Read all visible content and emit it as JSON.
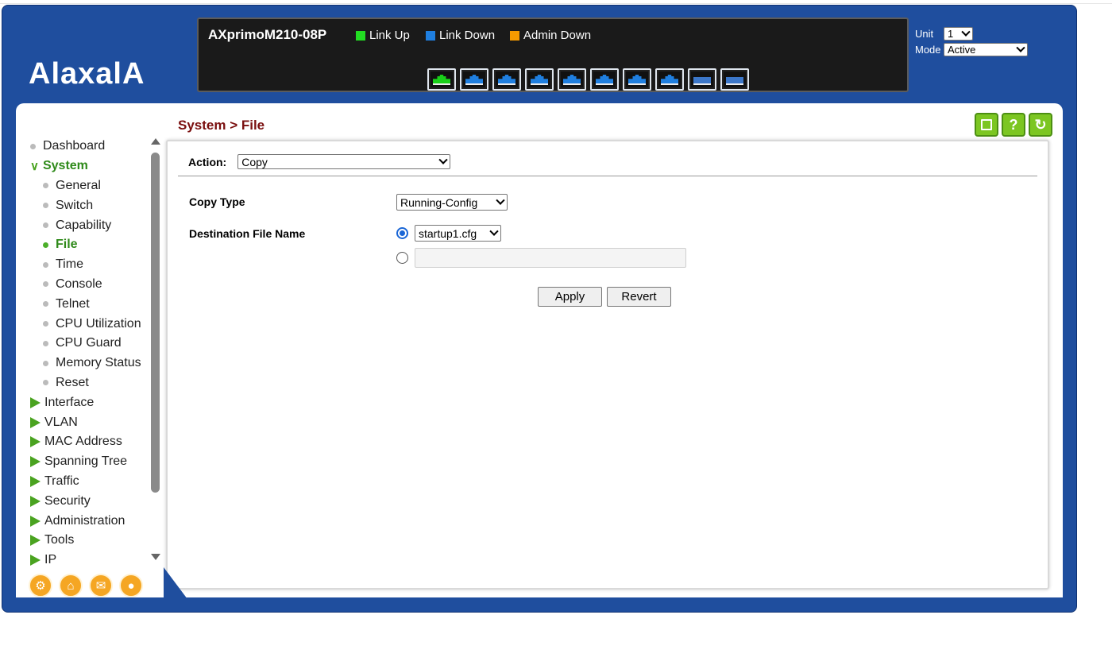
{
  "brand": {
    "logo_text": "AlaxalA"
  },
  "device": {
    "model": "AXprimoM210-08P",
    "legend": [
      {
        "label": "Link Up",
        "color": "#22dd22"
      },
      {
        "label": "Link Down",
        "color": "#1f7fe0"
      },
      {
        "label": "Admin Down",
        "color": "#f59a00"
      }
    ],
    "ports": [
      "up",
      "down",
      "down",
      "down",
      "down",
      "down",
      "down",
      "down",
      "sfp",
      "sfp"
    ]
  },
  "unit_mode": {
    "unit_label": "Unit",
    "unit_value": "1",
    "mode_label": "Mode",
    "mode_value": "Active"
  },
  "nav": {
    "items": [
      {
        "label": "Dashboard",
        "kind": "leaf"
      },
      {
        "label": "System",
        "kind": "open"
      },
      {
        "label": "General",
        "kind": "sub"
      },
      {
        "label": "Switch",
        "kind": "sub"
      },
      {
        "label": "Capability",
        "kind": "sub"
      },
      {
        "label": "File",
        "kind": "sub-active"
      },
      {
        "label": "Time",
        "kind": "sub"
      },
      {
        "label": "Console",
        "kind": "sub"
      },
      {
        "label": "Telnet",
        "kind": "sub"
      },
      {
        "label": "CPU Utilization",
        "kind": "sub"
      },
      {
        "label": "CPU Guard",
        "kind": "sub"
      },
      {
        "label": "Memory Status",
        "kind": "sub"
      },
      {
        "label": "Reset",
        "kind": "sub"
      },
      {
        "label": "Interface",
        "kind": "closed"
      },
      {
        "label": "VLAN",
        "kind": "closed"
      },
      {
        "label": "MAC Address",
        "kind": "closed"
      },
      {
        "label": "Spanning Tree",
        "kind": "closed"
      },
      {
        "label": "Traffic",
        "kind": "closed"
      },
      {
        "label": "Security",
        "kind": "closed"
      },
      {
        "label": "Administration",
        "kind": "closed"
      },
      {
        "label": "Tools",
        "kind": "closed"
      },
      {
        "label": "IP",
        "kind": "closed"
      }
    ]
  },
  "page": {
    "title": "System > File",
    "action_label": "Action:",
    "action_value": "Copy",
    "copy_type_label": "Copy Type",
    "copy_type_value": "Running-Config",
    "dest_label": "Destination File Name",
    "dest_value": "startup1.cfg",
    "dest_custom_value": "",
    "apply_label": "Apply",
    "revert_label": "Revert"
  },
  "toolbar_icons": [
    "save-icon",
    "help-icon",
    "refresh-icon"
  ],
  "footer_icons": [
    "sitemap-icon",
    "home-icon",
    "mail-icon",
    "globe-icon"
  ]
}
